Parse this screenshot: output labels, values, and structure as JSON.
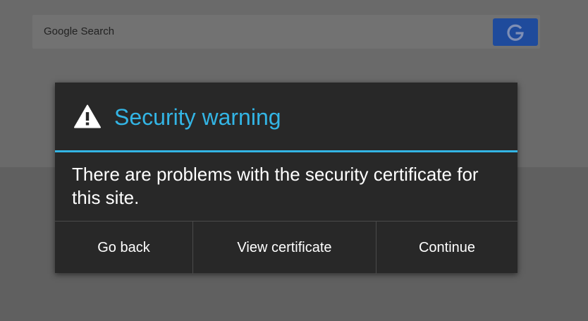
{
  "search": {
    "placeholder": "Google Search",
    "button_icon": "google-g-icon"
  },
  "dialog": {
    "title": "Security warning",
    "icon": "warning-triangle-icon",
    "message": "There are problems with the security certificate for this site.",
    "buttons": {
      "back": "Go back",
      "view_certificate": "View certificate",
      "continue": "Continue"
    }
  },
  "colors": {
    "accent": "#33b5e5",
    "dialog_background": "#282828",
    "search_button": "#1f4b9c",
    "overlay": "#6b6b6b"
  }
}
